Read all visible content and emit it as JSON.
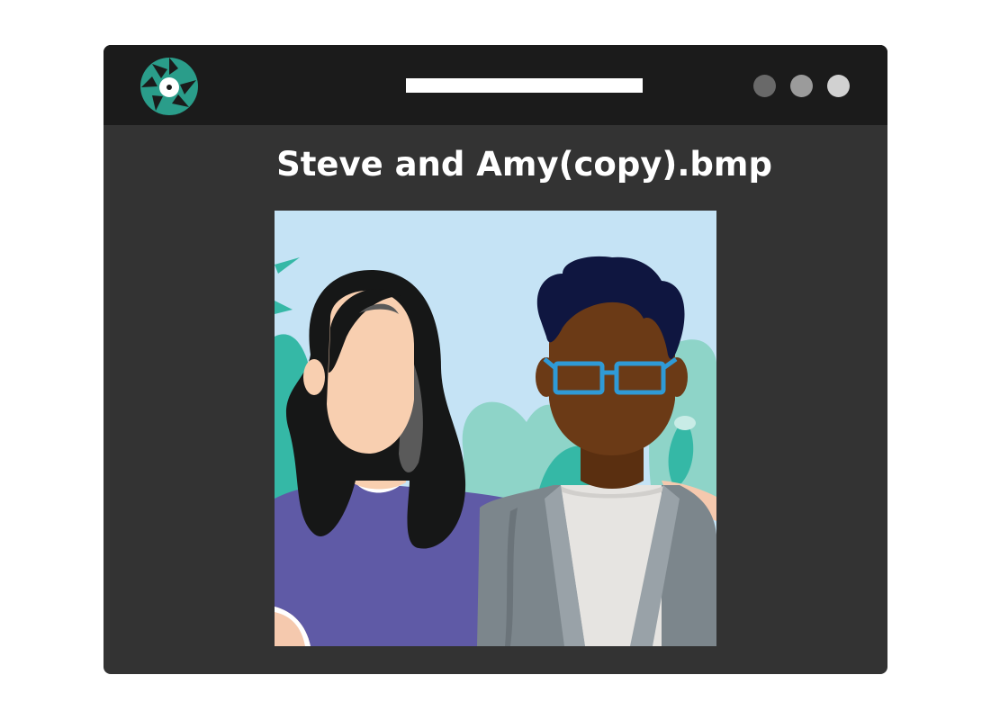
{
  "window": {
    "file_name": "Steve and Amy(copy).bmp",
    "app_icon": "camera-aperture-icon",
    "controls": [
      "minimize-button",
      "maximize-button",
      "close-button"
    ]
  },
  "photo": {
    "subject": "illustration-of-two-people",
    "icon": "photo-image"
  },
  "colors": {
    "titlebar": "#1b1b1b",
    "window_body": "#333333",
    "accent": "#2a9d8a",
    "sky": "#c5e3f5"
  }
}
